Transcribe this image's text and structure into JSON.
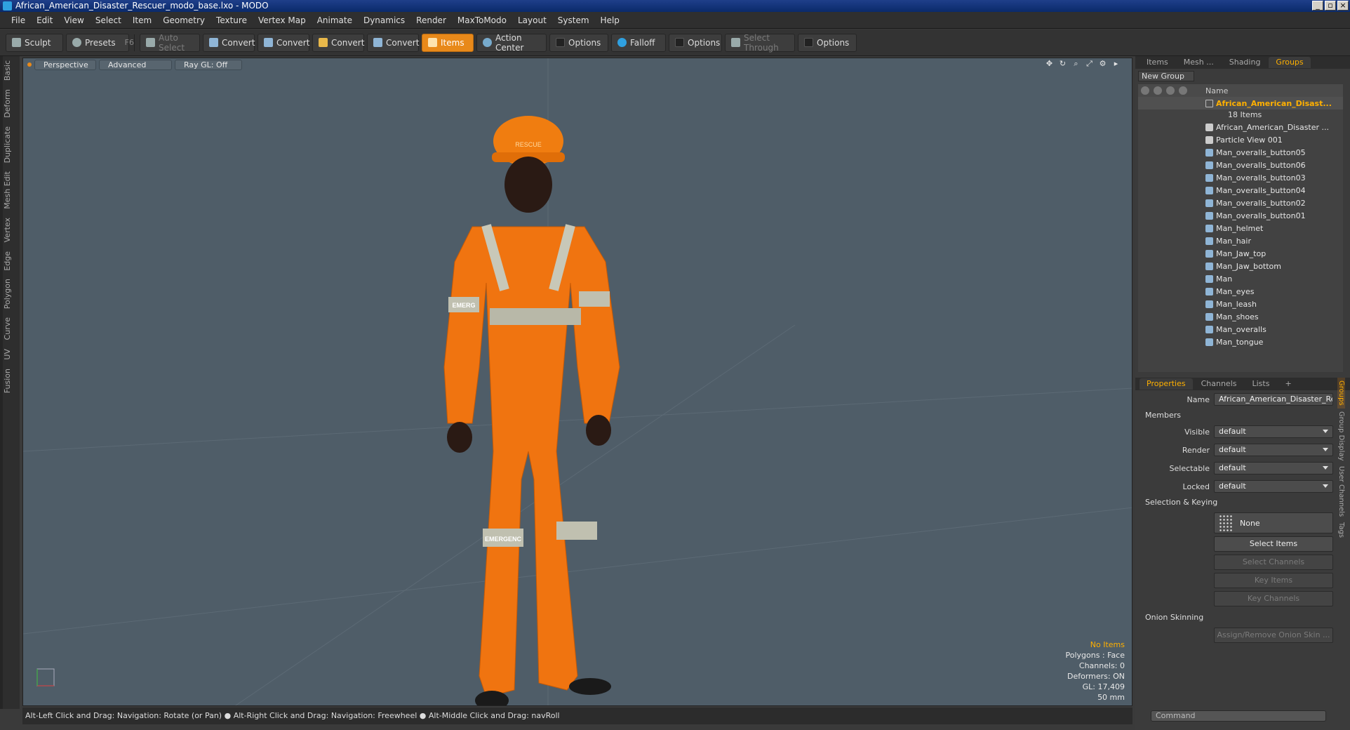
{
  "window": {
    "title": "African_American_Disaster_Rescuer_modo_base.lxo - MODO"
  },
  "menubar": {
    "items": [
      "File",
      "Edit",
      "View",
      "Select",
      "Item",
      "Geometry",
      "Texture",
      "Vertex Map",
      "Animate",
      "Dynamics",
      "Render",
      "MaxToModo",
      "Layout",
      "System",
      "Help"
    ]
  },
  "toolbar": {
    "sculpt": "Sculpt",
    "presets": "Presets",
    "presets_key": "F6",
    "auto_select": "Auto Select",
    "convert1": "Convert",
    "convert2": "Convert",
    "convert3": "Convert",
    "convert4": "Convert",
    "items": "Items",
    "action_center": "Action Center",
    "options1": "Options",
    "falloff": "Falloff",
    "options2": "Options",
    "select_through": "Select Through",
    "options3": "Options"
  },
  "left_tabs": [
    "Basic",
    "Deform",
    "Duplicate",
    "Mesh Edit",
    "Vertex",
    "Edge",
    "Polygon",
    "Curve",
    "UV",
    "Fusion"
  ],
  "viewport": {
    "view": "Perspective",
    "shading": "Advanced",
    "raygl": "Ray GL: Off",
    "info": {
      "no_items": "No Items",
      "polygons": "Polygons : Face",
      "channels": "Channels: 0",
      "deformers": "Deformers: ON",
      "gl": "GL: 17,409",
      "focal": "50 mm"
    },
    "helmet_text": "RESCUE",
    "arm_text": "EMERG",
    "leg_text": "EMERGENC"
  },
  "status": {
    "text": "Alt-Left Click and Drag: Navigation: Rotate (or Pan) ●  Alt-Right Click and Drag: Navigation: Freewheel ●  Alt-Middle Click and Drag: navRoll"
  },
  "right_panel": {
    "tabs": [
      "Items",
      "Mesh ...",
      "Shading",
      "Groups"
    ],
    "new_group": "New Group",
    "tree_header": "Name",
    "group_name": "African_American_Disast...",
    "group_count": "18 Items",
    "children": [
      "African_American_Disaster ...",
      "Particle View 001",
      "Man_overalls_button05",
      "Man_overalls_button06",
      "Man_overalls_button03",
      "Man_overalls_button04",
      "Man_overalls_button02",
      "Man_overalls_button01",
      "Man_helmet",
      "Man_hair",
      "Man_Jaw_top",
      "Man_Jaw_bottom",
      "Man",
      "Man_eyes",
      "Man_leash",
      "Man_shoes",
      "Man_overalls",
      "Man_tongue"
    ]
  },
  "properties": {
    "tabs": [
      "Properties",
      "Channels",
      "Lists",
      "+"
    ],
    "name_label": "Name",
    "name_value": "African_American_Disaster_Resc",
    "members": "Members",
    "visible_label": "Visible",
    "visible_value": "default",
    "render_label": "Render",
    "render_value": "default",
    "selectable_label": "Selectable",
    "selectable_value": "default",
    "locked_label": "Locked",
    "locked_value": "default",
    "selection_keying": "Selection & Keying",
    "none": "None",
    "select_items": "Select Items",
    "select_channels": "Select Channels",
    "key_items": "Key Items",
    "key_channels": "Key Channels",
    "onion": "Onion Skinning",
    "assign_onion": "Assign/Remove Onion Skin ...",
    "side_tabs": [
      "Groups",
      "Group Display",
      "User Channels",
      "Tags"
    ]
  },
  "command": {
    "placeholder": "Command"
  }
}
